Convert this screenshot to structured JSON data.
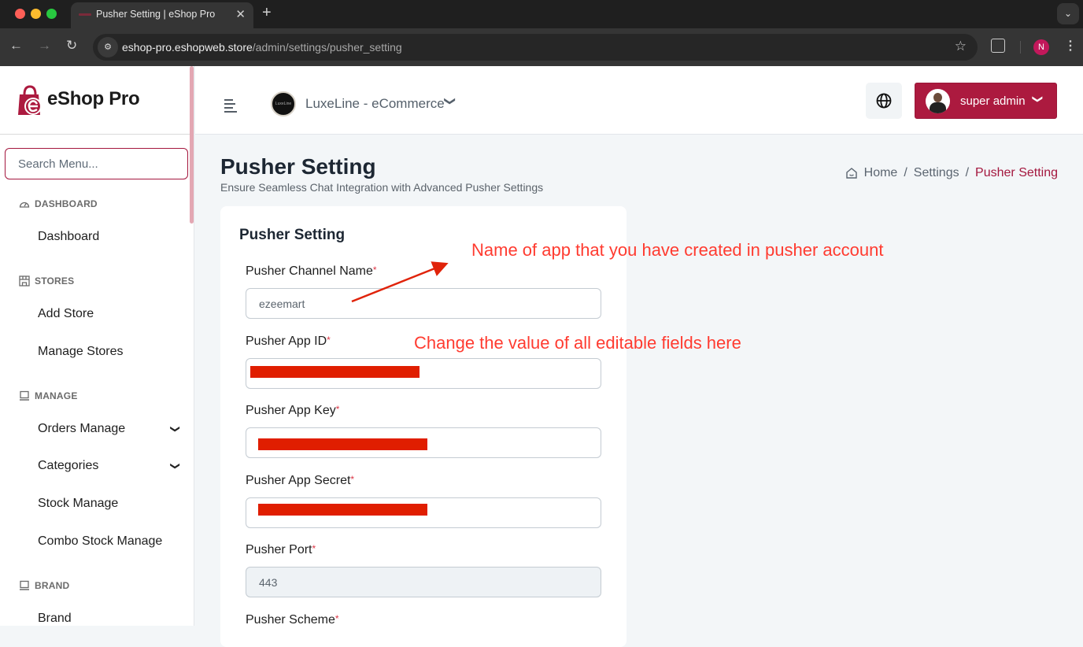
{
  "browser": {
    "tab_title": "Pusher Setting | eShop Pro",
    "url_host": "eshop-pro.eshopweb.store",
    "url_path": "/admin/settings/pusher_setting",
    "profile_initial": "N",
    "icons": {
      "back": "←",
      "forward": "→",
      "reload": "↻",
      "close": "✕",
      "new_tab": "+",
      "tab_menu": "⌄",
      "site_info": "⚙",
      "bookmark": "☆",
      "menu": "⋮"
    }
  },
  "sidebar": {
    "brand": "eShop Pro",
    "search_placeholder": "Search Menu...",
    "sections": [
      {
        "title": "DASHBOARD",
        "icon": "gauge-icon",
        "items": [
          {
            "label": "Dashboard"
          }
        ]
      },
      {
        "title": "STORES",
        "icon": "store-icon",
        "items": [
          {
            "label": "Add Store"
          },
          {
            "label": "Manage Stores"
          }
        ]
      },
      {
        "title": "MANAGE",
        "icon": "laptop-icon",
        "items": [
          {
            "label": "Orders Manage",
            "expandable": true
          },
          {
            "label": "Categories",
            "expandable": true
          },
          {
            "label": "Stock Manage"
          },
          {
            "label": "Combo Stock Manage"
          }
        ]
      },
      {
        "title": "BRAND",
        "icon": "laptop-icon",
        "items": [
          {
            "label": "Brand"
          }
        ]
      }
    ],
    "chevron": "⌄"
  },
  "topbar": {
    "store_name": "LuxeLine - eCommerce",
    "store_logo_text": "LuxeLine",
    "user_name": "super admin",
    "chevron": "⌄"
  },
  "page": {
    "title": "Pusher Setting",
    "subtitle": "Ensure Seamless Chat Integration with Advanced Pusher Settings",
    "breadcrumb": [
      "Home",
      "Settings",
      "Pusher Setting"
    ],
    "separator": "/"
  },
  "form": {
    "title": "Pusher Setting",
    "required_mark": "*",
    "fields": [
      {
        "label": "Pusher Channel Name",
        "value": "ezeemart",
        "redacted": false
      },
      {
        "label": "Pusher App ID",
        "value": "",
        "redacted": true
      },
      {
        "label": "Pusher App Key",
        "value": "",
        "redacted": true
      },
      {
        "label": "Pusher App Secret",
        "value": "",
        "redacted": true
      },
      {
        "label": "Pusher Port",
        "value": "443",
        "disabled": true
      },
      {
        "label": "Pusher Scheme",
        "value": ""
      }
    ]
  },
  "annotations": [
    "Name of app that you have created in pusher account",
    "Change the value of all editable fields here"
  ],
  "colors": {
    "brand": "#ac1a3f",
    "annotation": "#ff3b30",
    "redaction": "#e01e00"
  }
}
